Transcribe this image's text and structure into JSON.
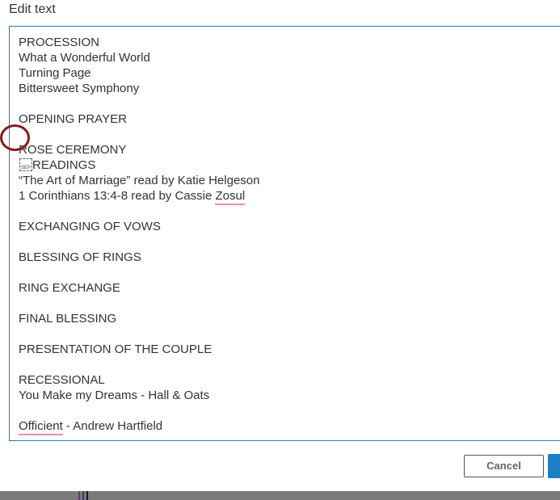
{
  "dialog": {
    "title": "Edit text"
  },
  "editor": {
    "lines": [
      "PROCESSION",
      "What a Wonderful World",
      "Turning Page",
      "Bittersweet Symphony",
      "OPENING PRAYER",
      "ROSE CEREMONY",
      "READINGS",
      "“The Art of Marriage” read by Katie Helgeson",
      "1 Corinthians 13:4-8 read by Cassie ",
      "Zosul",
      "EXCHANGING OF VOWS",
      "BLESSING OF RINGS",
      "RING EXCHANGE",
      "FINAL BLESSING",
      "PRESENTATION OF THE COUPLE",
      "RECESSIONAL",
      "You Make my Dreams - Hall & Oats",
      "Officient",
      " - Andrew Hartfield"
    ],
    "sep_marker": "SEP"
  },
  "buttons": {
    "cancel": "Cancel"
  },
  "colors": {
    "accent": "#1f7fc2",
    "spell_underline": "#e88fb0",
    "annotation_circle": "#8b1a1a"
  }
}
